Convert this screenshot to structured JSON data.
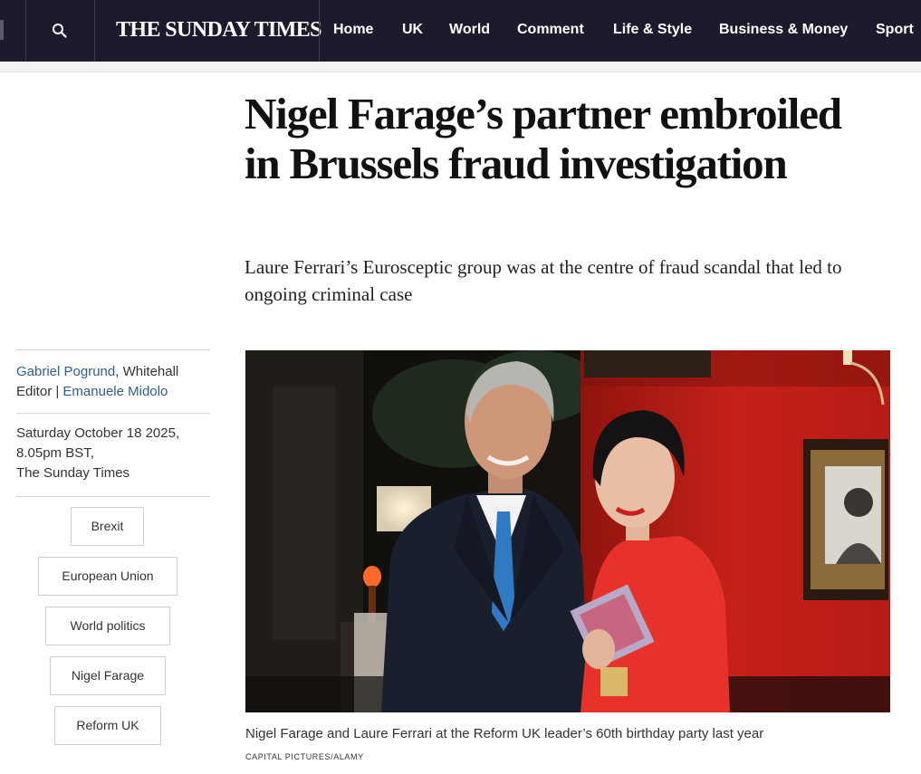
{
  "header": {
    "masthead": "THE SUNDAY TIMES",
    "nav": [
      "Home",
      "UK",
      "World",
      "Comment",
      "Life & Style",
      "Business & Money",
      "Sport"
    ],
    "search_icon": "search-icon",
    "colors": {
      "bar": "#1b1b2b",
      "text": "#ffffff"
    }
  },
  "article": {
    "headline": "Nigel Farage’s partner embroiled in Brussels fraud investigation",
    "standfirst": "Laure Ferrari’s Eurosceptic group was at the centre of fraud scandal that led to ongoing criminal case",
    "byline": {
      "author1": "Gabriel Pogrund",
      "role1": ", Whitehall Editor | ",
      "author2": "Emanuele Midolo"
    },
    "date": "Saturday October 18 2025, 8.05pm BST,",
    "publication": "The Sunday Times",
    "tags": [
      "Brexit",
      "European Union",
      "World politics",
      "Nigel Farage",
      "Reform UK"
    ],
    "caption": "Nigel Farage and Laure Ferrari at the Reform UK leader’s 60th birthday party last year",
    "credit": "CAPITAL PICTURES/ALAMY",
    "link_color": "#2f5f8f"
  }
}
